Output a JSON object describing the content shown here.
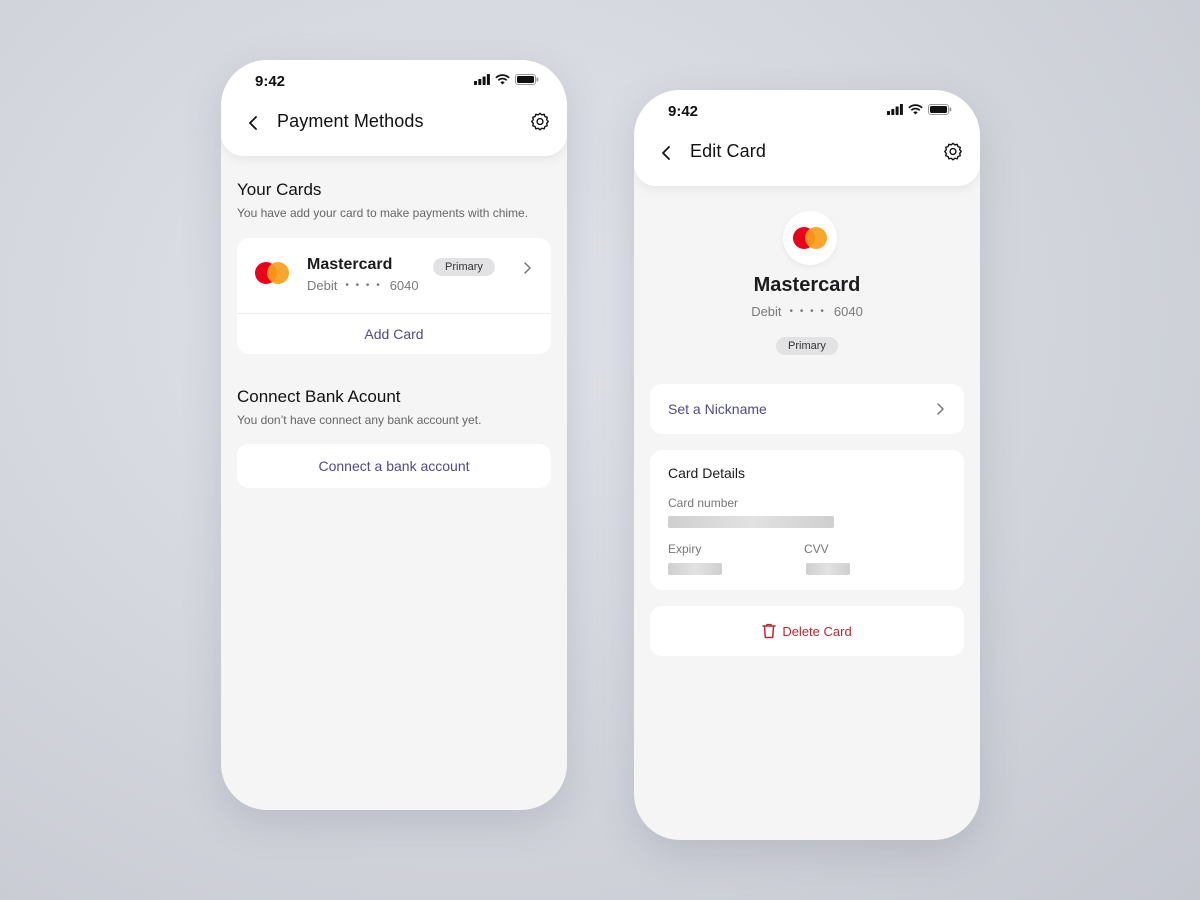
{
  "status_bar": {
    "time": "9:42"
  },
  "payment_methods": {
    "title": "Payment Methods",
    "your_cards": {
      "heading": "Your Cards",
      "subtitle": "You have add your card to make payments with chime.",
      "card": {
        "name": "Mastercard",
        "type": "Debit",
        "mask": "• • • •",
        "last4": "6040",
        "badge": "Primary"
      },
      "add_card_label": "Add Card"
    },
    "bank": {
      "heading": "Connect Bank Acount",
      "subtitle": "You don’t have connect any bank account yet.",
      "connect_label": "Connect a bank account"
    }
  },
  "edit_card": {
    "title": "Edit Card",
    "card": {
      "name": "Mastercard",
      "type": "Debit",
      "mask": "• • • •",
      "last4": "6040",
      "badge": "Primary"
    },
    "nickname_label": "Set a Nickname",
    "details": {
      "heading": "Card Details",
      "card_number_label": "Card number",
      "expiry_label": "Expiry",
      "cvv_label": "CVV"
    },
    "delete_label": "Delete Card"
  },
  "colors": {
    "accent": "#4e4a8e",
    "danger": "#c0262d",
    "mastercard_red": "#eb001b",
    "mastercard_orange": "#f79e1b"
  },
  "icons": [
    "back-icon",
    "gear-icon",
    "signal-icon",
    "wifi-icon",
    "battery-icon",
    "chevron-right-icon",
    "mastercard-logo",
    "trash-icon"
  ]
}
